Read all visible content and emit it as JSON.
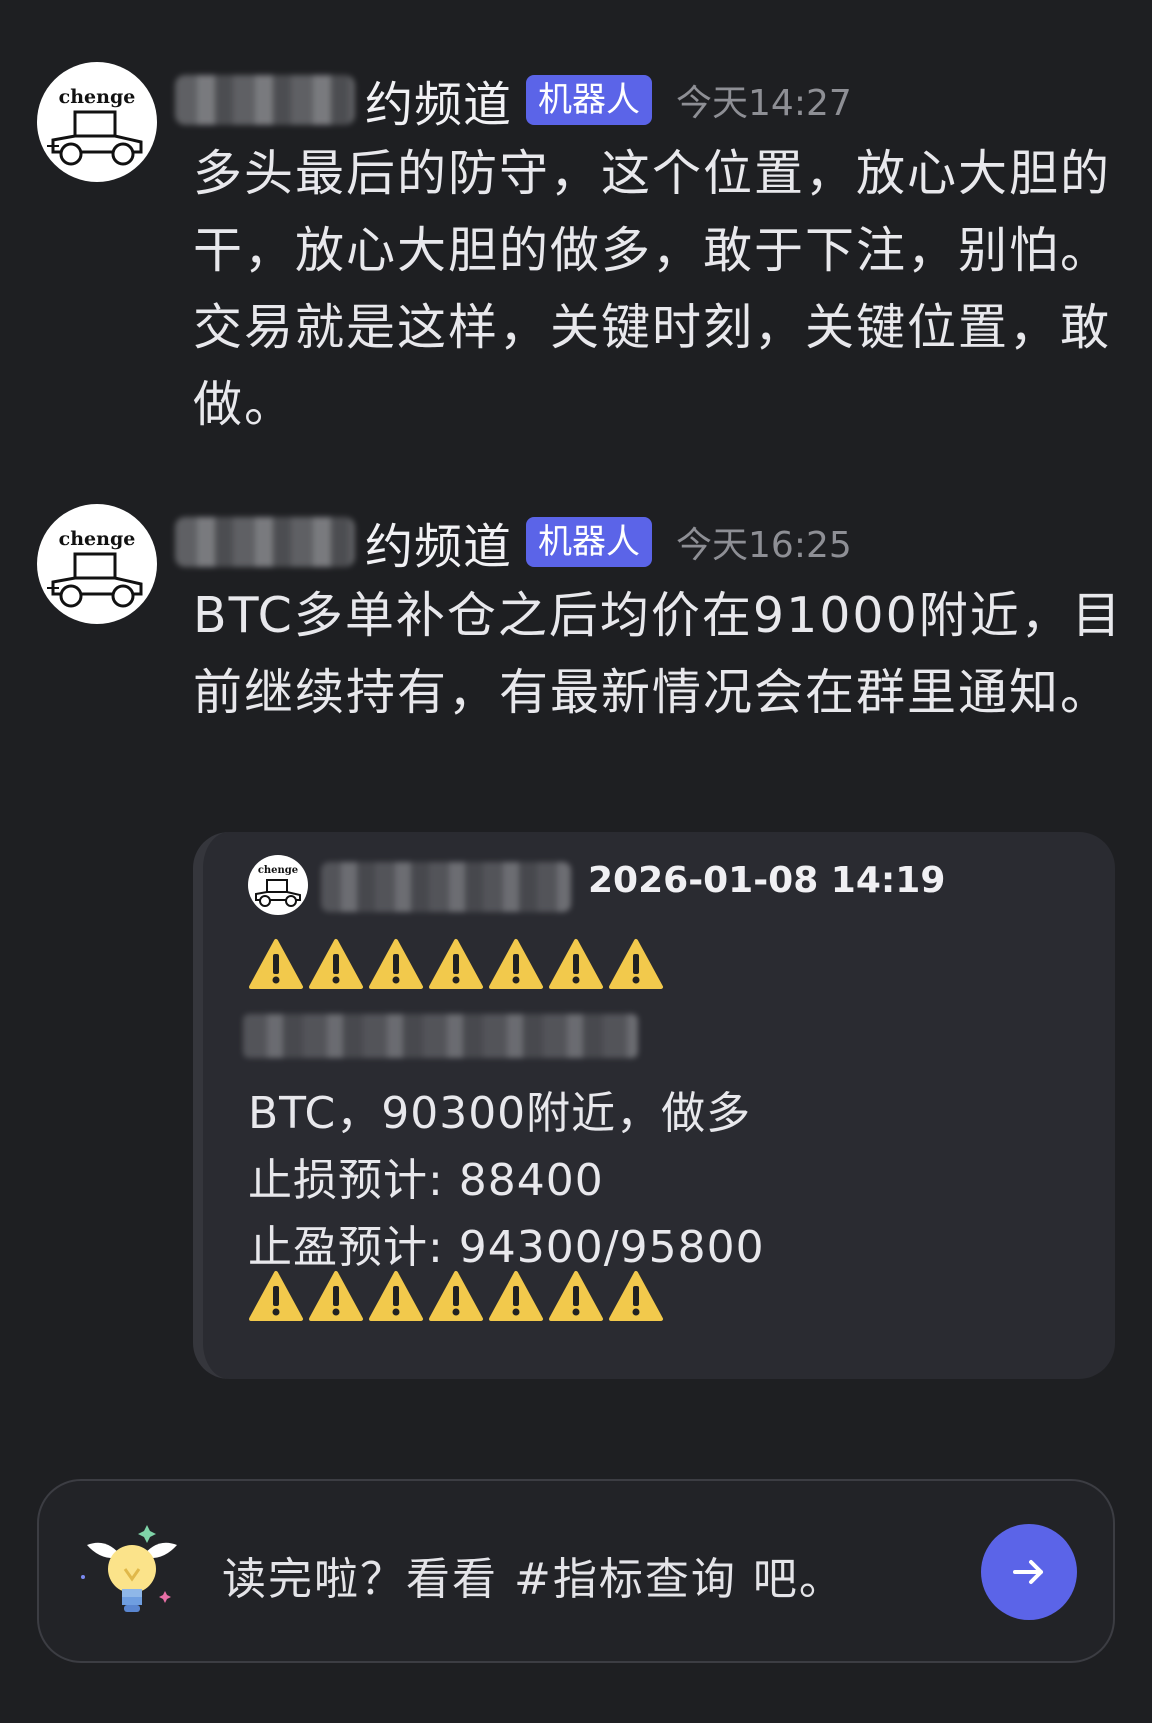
{
  "messages": [
    {
      "avatar_text": "chenge",
      "channel": "约频道",
      "badge": "机器人",
      "time": "今天14:27",
      "text": "多头最后的防守，这个位置，放心大胆的干，放心大胆的做多，敢于下注，别怕。交易就是这样，关键时刻，关键位置，敢做。"
    },
    {
      "avatar_text": "chenge",
      "channel": "约频道",
      "badge": "机器人",
      "time": "今天16:25",
      "text": "BTC多单补仓之后均价在91000附近，目前继续持有，有最新情况会在群里通知。"
    }
  ],
  "quote": {
    "avatar_text": "chenge",
    "date": "2026-01-08 14:19",
    "line1": "BTC，90300附近，做多",
    "line2": "止损预计: 88400",
    "line3": "止盈预计: 94300/95800",
    "warning_icon": "warning-icon",
    "warning_count": 7
  },
  "composer": {
    "text": "读完啦？看看 #指标查询 吧。",
    "icon": "lightbulb-icon",
    "send_icon": "arrow-right-icon"
  },
  "colors": {
    "background": "#1e1f22",
    "accent": "#5b64e8",
    "card": "#2a2b31",
    "warning": "#f2c94c"
  }
}
